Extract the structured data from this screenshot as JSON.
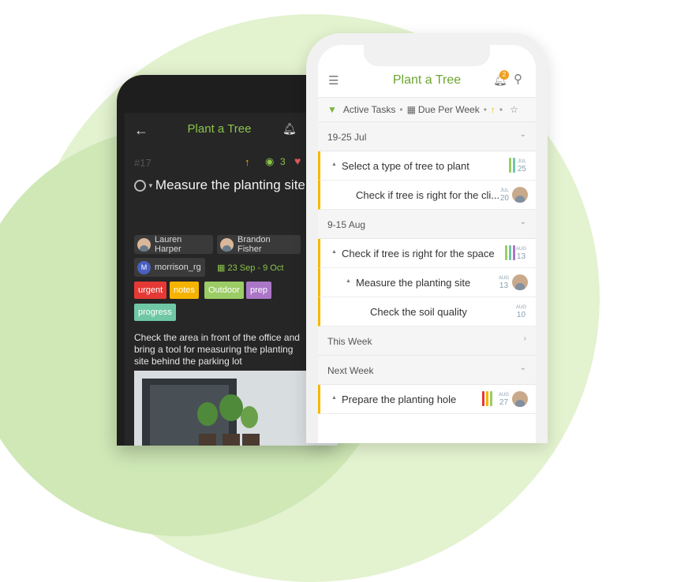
{
  "android": {
    "title": "Plant a Tree",
    "task_id": "#17",
    "watchers": "3",
    "task_title": "Measure the planting site",
    "assignees": [
      "Lauren Harper",
      "Brandon Fisher",
      "morrison_rg"
    ],
    "member_initial": "M",
    "date_range": "23 Sep - 9 Oct",
    "tags": [
      {
        "label": "urgent",
        "color": "#e53935"
      },
      {
        "label": "notes",
        "color": "#f5b300"
      },
      {
        "label": "Outdoor",
        "color": "#9ccc65"
      },
      {
        "label": "prep",
        "color": "#ab76c8"
      },
      {
        "label": "progress",
        "color": "#6fc7a6"
      }
    ],
    "description": "Check the area in front of the office and bring a tool for measuring the planting site behind the parking lot"
  },
  "iphone": {
    "title": "Plant a Tree",
    "notification_count": "2",
    "filters": {
      "active": "Active Tasks",
      "due": "Due Per Week"
    },
    "sections": {
      "s1": "19-25 Jul",
      "s2": "9-15 Aug",
      "s3": "This Week",
      "s4": "Next Week"
    },
    "rows": [
      {
        "text": "Select a type of tree to plant",
        "month": "JUL",
        "day": "25"
      },
      {
        "text": "Check if tree is right for the cli...",
        "month": "JUL",
        "day": "20"
      },
      {
        "text": "Check if tree is right for the space",
        "month": "AUG",
        "day": "13"
      },
      {
        "text": "Measure the planting site",
        "month": "AUG",
        "day": "13"
      },
      {
        "text": "Check the soil quality",
        "month": "AUG",
        "day": "10"
      },
      {
        "text": "Prepare the planting hole",
        "month": "AUG",
        "day": "27"
      }
    ]
  },
  "colors": {
    "accent_green": "#6aa531",
    "priority_yellow": "#f5b800",
    "bg_blob": "#e3f2cf"
  }
}
